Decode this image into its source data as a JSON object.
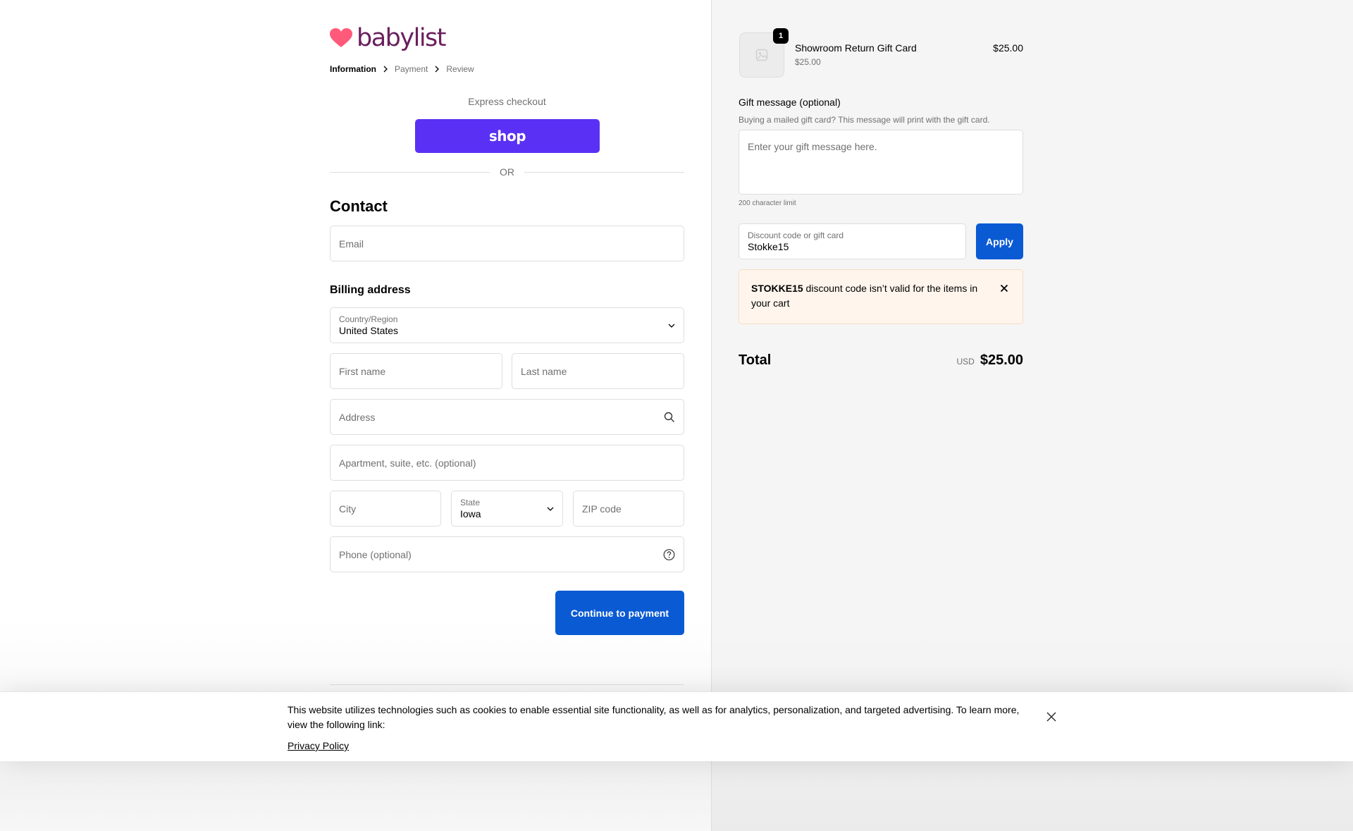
{
  "brand": {
    "name": "babylist",
    "heart_color": "#ff5a7a",
    "text_color": "#6b1f5e"
  },
  "breadcrumb": {
    "items": [
      {
        "label": "Information",
        "current": true
      },
      {
        "label": "Payment",
        "current": false
      },
      {
        "label": "Review",
        "current": false
      }
    ]
  },
  "express": {
    "title": "Express checkout",
    "shop_label": "shop",
    "shop_color": "#5a31f4",
    "or_label": "OR"
  },
  "contact": {
    "heading": "Contact",
    "email_placeholder": "Email"
  },
  "billing": {
    "heading": "Billing address",
    "country": {
      "label": "Country/Region",
      "value": "United States"
    },
    "first_name_placeholder": "First name",
    "last_name_placeholder": "Last name",
    "address_placeholder": "Address",
    "apartment_placeholder": "Apartment, suite, etc. (optional)",
    "city_placeholder": "City",
    "state": {
      "label": "State",
      "value": "Iowa"
    },
    "zip_placeholder": "ZIP code",
    "phone_placeholder": "Phone (optional)"
  },
  "continue_label": "Continue to payment",
  "accent_color": "#0a5ad4",
  "order": {
    "item": {
      "name": "Showroom Return Gift Card",
      "sub_price": "$25.00",
      "price": "$25.00",
      "quantity": "1"
    },
    "gift": {
      "title": "Gift message (optional)",
      "help": "Buying a mailed gift card? This message will print with the gift card.",
      "placeholder": "Enter your gift message here.",
      "limit": "200 character limit"
    },
    "discount": {
      "label": "Discount code or gift card",
      "value": "Stokke15",
      "apply_label": "Apply"
    },
    "alert": {
      "code": "STOKKE15",
      "message": " discount code isn’t valid for the items in your cart"
    },
    "total": {
      "label": "Total",
      "currency": "USD",
      "amount": "$25.00"
    }
  },
  "cookie": {
    "text": "This website utilizes technologies such as cookies to enable essential site functionality, as well as for analytics, personalization, and targeted advertising. To learn more, view the following link:",
    "link": "Privacy Policy"
  }
}
